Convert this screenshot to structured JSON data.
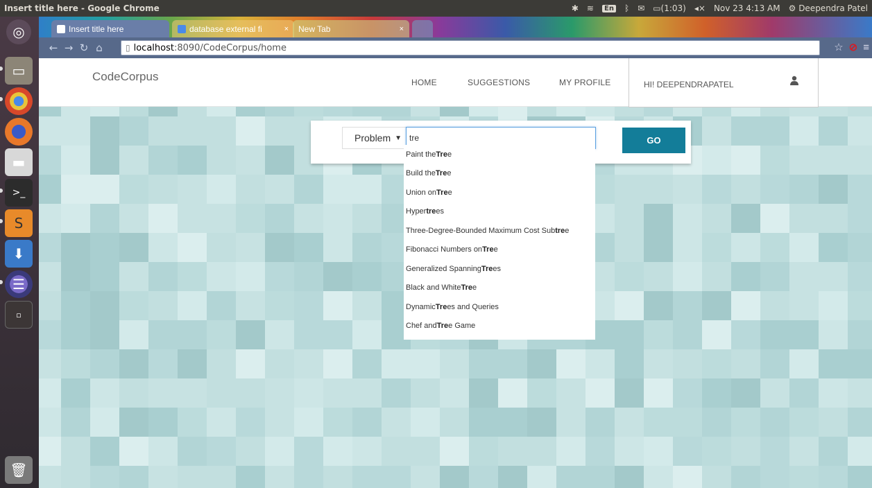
{
  "os_panel": {
    "window_title": "Insert title here - Google Chrome",
    "keyboard": "En",
    "battery": "(1:03)",
    "datetime": "Nov 23  4:13 AM",
    "user": "Deependra Patel"
  },
  "launcher": {
    "items": [
      "ubuntu-dash",
      "files",
      "chrome",
      "firefox",
      "disk",
      "terminal",
      "sublime-text",
      "installer",
      "eclipse",
      "workspace-switcher",
      "trash"
    ]
  },
  "browser": {
    "tabs": [
      {
        "label": "Insert title here",
        "active": true
      },
      {
        "label": "database external fi",
        "active": false
      },
      {
        "label": "New Tab",
        "active": false
      }
    ],
    "url_host": "localhost",
    "url_path": ":8090/CodeCorpus/home"
  },
  "navbar": {
    "brand": "CodeCorpus",
    "links": [
      "HOME",
      "SUGGESTIONS",
      "MY PROFILE"
    ],
    "greeting": "HI! DEEPENDRAPATEL"
  },
  "search": {
    "type_selected": "Problem",
    "query": "tre",
    "go_label": "GO"
  },
  "suggestions": [
    {
      "pre": "Paint the ",
      "match": "Tre",
      "post": "e"
    },
    {
      "pre": "Build the ",
      "match": "Tre",
      "post": "e"
    },
    {
      "pre": "Union on ",
      "match": "Tre",
      "post": "e"
    },
    {
      "pre": "Hyper",
      "match": "tre",
      "post": "es"
    },
    {
      "pre": "Three-Degree-Bounded Maximum Cost Sub",
      "match": "tre",
      "post": "e"
    },
    {
      "pre": "Fibonacci Numbers on ",
      "match": "Tre",
      "post": "e"
    },
    {
      "pre": "Generalized Spanning ",
      "match": "Tre",
      "post": "es"
    },
    {
      "pre": "Black and White ",
      "match": "Tre",
      "post": "e"
    },
    {
      "pre": "Dynamic ",
      "match": "Tre",
      "post": "es and Queries"
    },
    {
      "pre": "Chef and ",
      "match": "Tre",
      "post": "e Game"
    }
  ]
}
